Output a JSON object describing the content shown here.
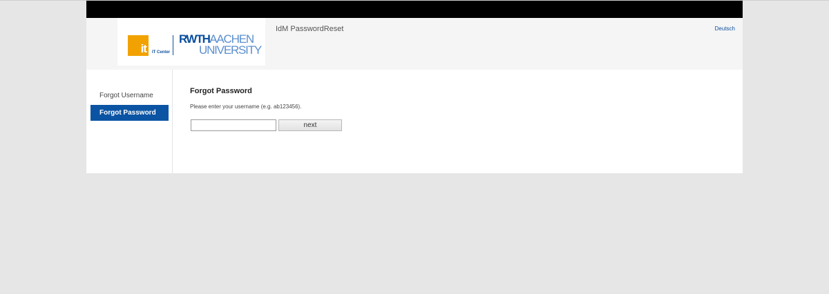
{
  "header": {
    "logo": {
      "it_mark": "it",
      "it_center": "IT Center",
      "rwth_bold": "RWTH",
      "rwth_light": "AACHEN",
      "university": "UNIVERSITY"
    },
    "app_title": "IdM PasswordReset",
    "language_link": "Deutsch"
  },
  "sidebar": {
    "items": [
      {
        "label": "Forgot Username",
        "active": false
      },
      {
        "label": "Forgot Password",
        "active": true
      }
    ]
  },
  "main": {
    "title": "Forgot Password",
    "instruction": "Please enter your username (e.g. ab123456).",
    "username_value": "",
    "next_label": "next"
  },
  "colors": {
    "accent": "#0b54a4",
    "it_orange": "#f2a200",
    "page_bg": "#e6e6e6"
  }
}
